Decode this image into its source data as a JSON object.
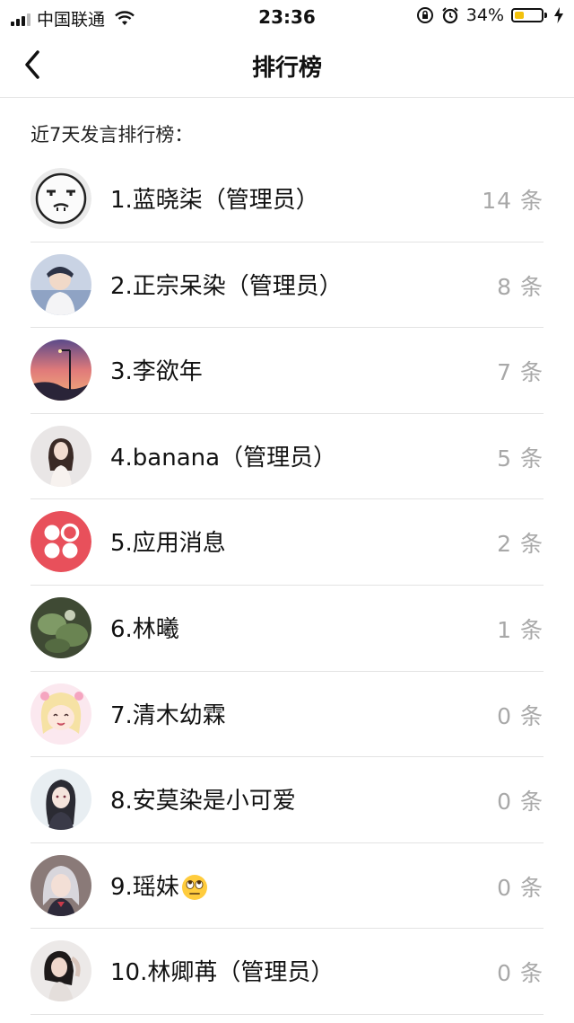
{
  "status_bar": {
    "carrier": "中国联通",
    "time": "23:36",
    "battery_percent": "34%",
    "battery_level": 0.34,
    "battery_color": "#f3c20d"
  },
  "nav": {
    "title": "排行榜"
  },
  "section": {
    "label": "近7天发言排行榜："
  },
  "ranking": [
    {
      "name": "1.蓝晓柒（管理员）",
      "count": "14 条",
      "avatar": "face-sketch"
    },
    {
      "name": "2.正宗呆染（管理员）",
      "count": "8 条",
      "avatar": "photo"
    },
    {
      "name": "3.李欲年",
      "count": "7 条",
      "avatar": "sunset"
    },
    {
      "name": "4.banana（管理员）",
      "count": "5 条",
      "avatar": "photo"
    },
    {
      "name": "5.应用消息",
      "count": "2 条",
      "avatar": "app-logo"
    },
    {
      "name": "6.林曦",
      "count": "1 条",
      "avatar": "photo"
    },
    {
      "name": "7.清木幼霖",
      "count": "0 条",
      "avatar": "anime"
    },
    {
      "name": "8.安莫染是小可爱",
      "count": "0 条",
      "avatar": "anime"
    },
    {
      "name": "9.瑶妹",
      "count": "0 条",
      "avatar": "anime",
      "emoji": "eye-roll-emoji"
    },
    {
      "name": "10.林卿苒（管理员）",
      "count": "0 条",
      "avatar": "photo"
    }
  ],
  "colors": {
    "app_logo_red": "#e8505b",
    "count_gray": "#a8a8a8",
    "divider": "#e3e3e3"
  }
}
